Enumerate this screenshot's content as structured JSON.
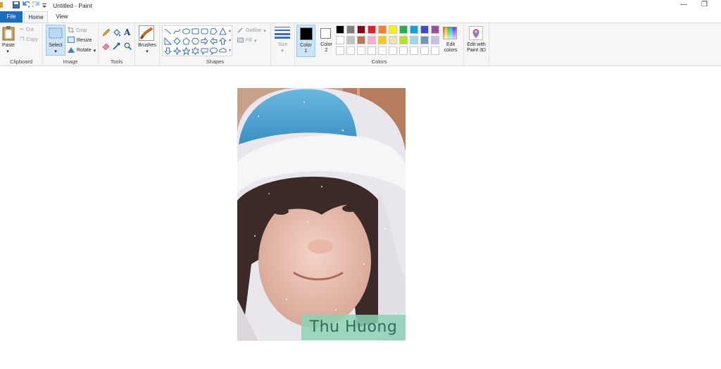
{
  "window": {
    "title": "Untitled - Paint",
    "minimize": "—",
    "restore": "❐"
  },
  "tabs": [
    {
      "label": "File"
    },
    {
      "label": "Home"
    },
    {
      "label": "View"
    }
  ],
  "clipboard": {
    "paste": "Paste",
    "cut": "Cut",
    "copy": "Copy",
    "group": "Clipboard"
  },
  "image": {
    "select": "Select",
    "crop": "Crop",
    "resize": "Resize",
    "rotate": "Rotate",
    "group": "Image"
  },
  "tools": {
    "group": "Tools"
  },
  "brushes": {
    "label": "Brushes"
  },
  "shapes": {
    "outline": "Outline",
    "fill": "Fill",
    "group": "Shapes"
  },
  "size": {
    "label": "Size"
  },
  "colors": {
    "color1_label": "Color",
    "color1_num": "1",
    "color2_label": "Color",
    "color2_num": "2",
    "edit_label": "Edit",
    "edit_label2": "colors",
    "group": "Colors",
    "color1": "#000000",
    "color2": "#ffffff",
    "palette_row1": [
      "#000000",
      "#7f7f7f",
      "#880015",
      "#ed1c24",
      "#ff7f27",
      "#fff200",
      "#22b14c",
      "#00a2e8",
      "#3f48cc",
      "#a349a4"
    ],
    "palette_row2": [
      "#ffffff",
      "#c3c3c3",
      "#b97a57",
      "#ffaec9",
      "#ffc90e",
      "#efe4b0",
      "#b5e61d",
      "#99d9ea",
      "#7092be",
      "#c8bfe7"
    ]
  },
  "paint3d": {
    "label": "Edit with",
    "label2": "Paint 3D"
  },
  "canvas": {
    "name_tag": "Thu Huong"
  }
}
